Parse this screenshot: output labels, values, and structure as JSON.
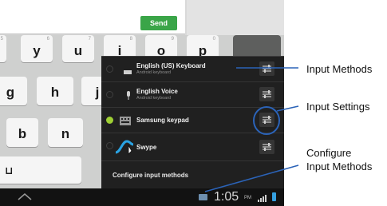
{
  "compose": {
    "send_label": "Send"
  },
  "keyboard": {
    "keys": [
      {
        "id": "5",
        "label": "5",
        "hint": ""
      },
      {
        "id": "y",
        "label": "y",
        "hint": "6"
      },
      {
        "id": "u",
        "label": "u",
        "hint": "7"
      },
      {
        "id": "i",
        "label": "i",
        "hint": "8"
      },
      {
        "id": "o",
        "label": "o",
        "hint": "9"
      },
      {
        "id": "p",
        "label": "p",
        "hint": "0"
      },
      {
        "id": "g",
        "label": "g",
        "hint": ""
      },
      {
        "id": "h",
        "label": "h",
        "hint": ""
      },
      {
        "id": "j",
        "label": "j",
        "hint": ""
      },
      {
        "id": "b",
        "label": "b",
        "hint": ""
      },
      {
        "id": "n",
        "label": "n",
        "hint": ""
      },
      {
        "id": "space",
        "label": "⊔",
        "hint": ""
      }
    ]
  },
  "input_methods": {
    "items": [
      {
        "title": "English (US) Keyboard",
        "subtitle": "Android keyboard",
        "selected": false,
        "icon": "keyboard-icon"
      },
      {
        "title": "English Voice",
        "subtitle": "Android keyboard",
        "selected": false,
        "icon": "microphone-icon"
      },
      {
        "title": "Samsung keypad",
        "subtitle": "",
        "selected": true,
        "icon": "keypad-icon"
      },
      {
        "title": "Swype",
        "subtitle": "",
        "selected": false,
        "icon": "swype-icon"
      }
    ],
    "configure_label": "Configure input methods"
  },
  "status_bar": {
    "time": "1:05",
    "ampm": "PM"
  },
  "callouts": {
    "input_methods": "Input Methods",
    "input_settings": "Input Settings",
    "configure_line1": "Configure",
    "configure_line2": "Input Methods"
  },
  "colors": {
    "send_button": "#3aa548",
    "selected_radio": "#9fd034",
    "highlight_circle": "#2b63b8",
    "battery": "#35a0e0"
  }
}
